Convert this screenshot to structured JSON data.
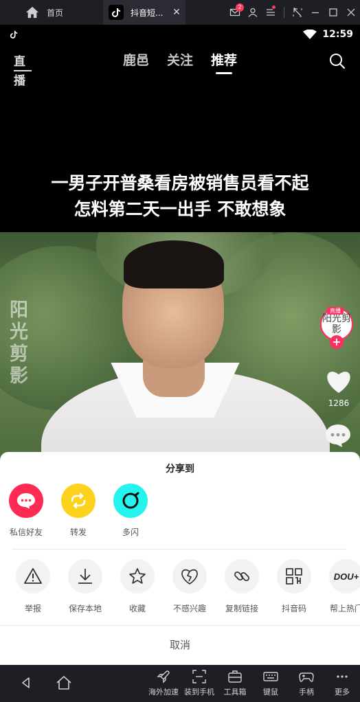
{
  "window": {
    "home_tab_label": "首页",
    "app_tab_label": "抖音短...",
    "tab_close": "✕",
    "mail_badge": "2"
  },
  "status": {
    "time": "12:59"
  },
  "topnav": {
    "live_label": "直播",
    "tabs": [
      {
        "label": "鹿邑",
        "active": false
      },
      {
        "label": "关注",
        "active": false
      },
      {
        "label": "推荐",
        "active": true
      }
    ]
  },
  "video": {
    "caption_line1": "一男子开普桑看房被销售员看不起",
    "caption_line2": "怎料第二天一出手 不敢想象",
    "watermark": "阳光剪影"
  },
  "rail": {
    "avatar_text": "阳光剪影",
    "avatar_live_tag": "直播",
    "follow_plus": "+",
    "like_count": "1286"
  },
  "share": {
    "title": "分享到",
    "primary": [
      {
        "label": "私信好友",
        "icon": "chat-bubble-icon",
        "color": "#fe2c55"
      },
      {
        "label": "转发",
        "icon": "repost-icon",
        "color": "#fdd21d"
      },
      {
        "label": "多闪",
        "icon": "duoshan-icon",
        "color": "#25f4ee"
      }
    ],
    "actions": [
      {
        "label": "举报",
        "icon": "report-icon"
      },
      {
        "label": "保存本地",
        "icon": "download-icon"
      },
      {
        "label": "收藏",
        "icon": "star-icon"
      },
      {
        "label": "不感兴趣",
        "icon": "broken-heart-icon"
      },
      {
        "label": "复制链接",
        "icon": "link-icon"
      },
      {
        "label": "抖音码",
        "icon": "qr-code-icon"
      },
      {
        "label": "帮上热门",
        "icon": "dou-plus-icon",
        "icon_text": "DOU+"
      }
    ],
    "cancel": "取消"
  },
  "bottombar": {
    "tools": [
      {
        "label": "海外加速",
        "icon": "rocket-icon"
      },
      {
        "label": "装到手机",
        "icon": "install-phone-icon"
      },
      {
        "label": "工具箱",
        "icon": "toolbox-icon"
      },
      {
        "label": "键鼠",
        "icon": "keyboard-icon"
      },
      {
        "label": "手柄",
        "icon": "gamepad-icon"
      },
      {
        "label": "更多",
        "icon": "more-icon"
      }
    ]
  }
}
